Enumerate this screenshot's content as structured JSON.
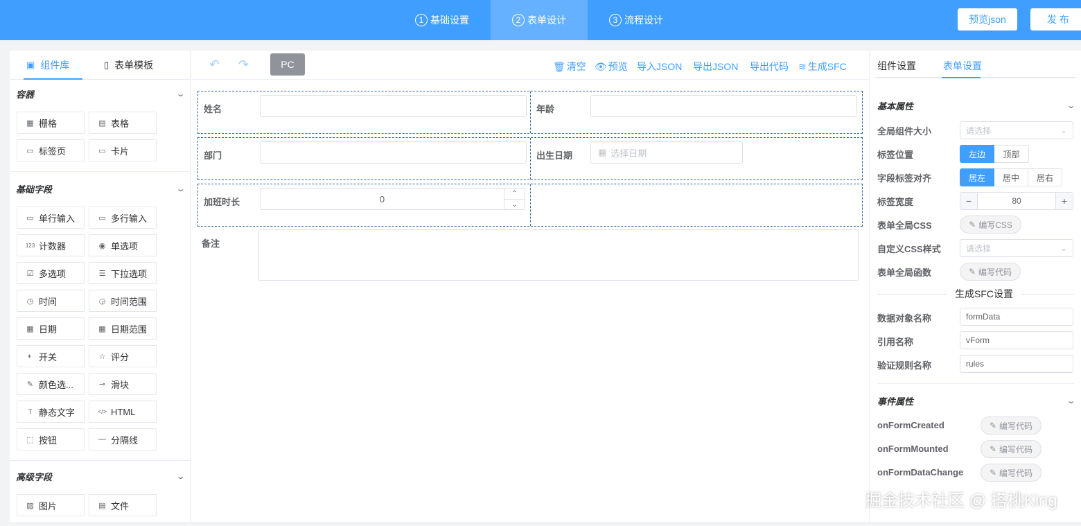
{
  "steps": [
    {
      "num": "1",
      "label": "基础设置"
    },
    {
      "num": "2",
      "label": "表单设计"
    },
    {
      "num": "3",
      "label": "流程设计"
    }
  ],
  "top_buttons": {
    "preview_json": "预览json",
    "publish": "发 布"
  },
  "left_tabs": {
    "components": "组件库",
    "templates": "表单模板"
  },
  "sections": {
    "container": {
      "title": "容器",
      "items": [
        "栅格",
        "表格",
        "标签页",
        "卡片"
      ]
    },
    "basic": {
      "title": "基础字段",
      "items": [
        "单行输入",
        "多行输入",
        "计数器",
        "单选项",
        "多选项",
        "下拉选项",
        "时间",
        "时间范围",
        "日期",
        "日期范围",
        "开关",
        "评分",
        "颜色选...",
        "滑块",
        "静态文字",
        "HTML",
        "按钮",
        "分隔线"
      ]
    },
    "advanced": {
      "title": "高级字段",
      "items": [
        "图片",
        "文件"
      ]
    }
  },
  "toolbar": {
    "pc": "PC",
    "clear": "清空",
    "preview": "预览",
    "import_json": "导入JSON",
    "export_json": "导出JSON",
    "export_code": "导出代码",
    "generate_sfc": "生成SFC"
  },
  "form": {
    "name": "姓名",
    "age": "年龄",
    "dept": "部门",
    "birth": "出生日期",
    "birth_placeholder": "选择日期",
    "overtime": "加班时长",
    "overtime_value": "0",
    "remark": "备注"
  },
  "right_tabs": {
    "component": "组件设置",
    "form": "表单设置"
  },
  "props": {
    "basic_title": "基本属性",
    "size_label": "全局组件大小",
    "size_placeholder": "请选择",
    "label_pos": "标签位置",
    "label_pos_opts": [
      "左边",
      "顶部"
    ],
    "label_align": "字段标签对齐",
    "label_align_opts": [
      "居左",
      "居中",
      "居右"
    ],
    "label_width": "标签宽度",
    "label_width_value": "80",
    "form_css": "表单全局CSS",
    "edit_css": "编写CSS",
    "custom_css": "自定义CSS样式",
    "custom_css_placeholder": "请选择",
    "form_func": "表单全局函数",
    "edit_code": "编写代码",
    "sfc_title": "生成SFC设置",
    "data_obj": "数据对象名称",
    "data_obj_value": "formData",
    "ref_name": "引用名称",
    "ref_name_value": "vForm",
    "rules_name": "验证规则名称",
    "rules_name_value": "rules",
    "event_title": "事件属性",
    "on_created": "onFormCreated",
    "on_mounted": "onFormMounted",
    "on_change": "onFormDataChange"
  },
  "watermark": "掘金技术社区 @ 搭桃King",
  "colors": {
    "primary": "#409eff",
    "topbar": "#409eff",
    "active_step": "#66b1ff",
    "pc_button": "#909399"
  }
}
